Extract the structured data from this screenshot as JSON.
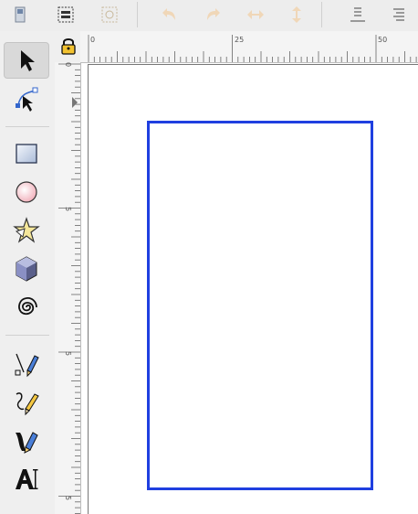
{
  "command_bar": {
    "buttons": [
      {
        "icon": "document-properties-icon"
      },
      {
        "icon": "layers-icon"
      },
      {
        "icon": "object-icon"
      },
      {
        "icon": "undo-icon"
      },
      {
        "icon": "redo-icon"
      },
      {
        "icon": "flip-horizontal-icon"
      },
      {
        "icon": "flip-vertical-icon"
      },
      {
        "icon": "align-bottom-icon"
      },
      {
        "icon": "align-text-icon"
      }
    ]
  },
  "toolbox": {
    "tools": [
      {
        "name": "selector",
        "icon": "arrow-pointer-icon",
        "active": true
      },
      {
        "name": "node-editor",
        "icon": "node-edit-icon"
      },
      {
        "name": "rectangle",
        "icon": "rectangle-icon"
      },
      {
        "name": "ellipse",
        "icon": "circle-icon"
      },
      {
        "name": "star",
        "icon": "star-icon"
      },
      {
        "name": "3d-box",
        "icon": "box-3d-icon"
      },
      {
        "name": "spiral",
        "icon": "spiral-icon"
      },
      {
        "name": "pen",
        "icon": "pen-bezier-icon"
      },
      {
        "name": "pencil",
        "icon": "pencil-icon"
      },
      {
        "name": "calligraphy",
        "icon": "calligraphy-icon"
      },
      {
        "name": "text",
        "icon": "text-tool-icon"
      }
    ]
  },
  "rulers": {
    "horizontal_labels": [
      "0",
      "25",
      "50"
    ],
    "vertical_labels": [
      "0",
      "5",
      "5",
      "5"
    ]
  },
  "colors": {
    "rectangle_stroke": "#1f3fe0",
    "canvas": "#ffffff",
    "toolbar_bg": "#ededed"
  }
}
